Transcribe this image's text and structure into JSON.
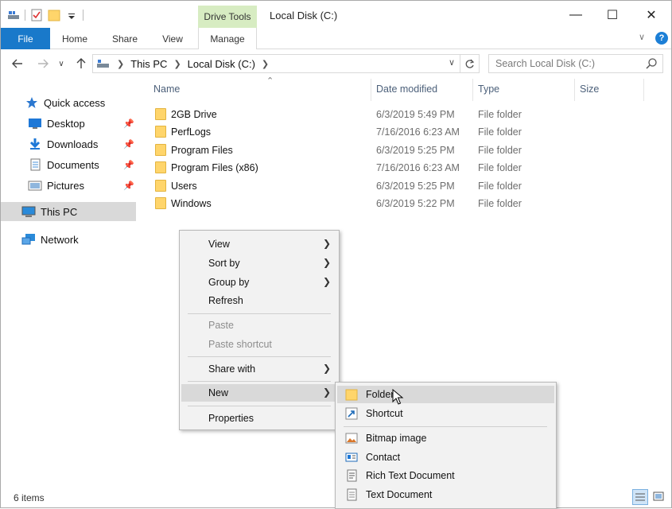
{
  "window": {
    "title": "Local Disk (C:)",
    "contextual_tab_group": "Drive Tools",
    "controls": {
      "minimize": "—",
      "maximize": "☐",
      "close": "✕"
    }
  },
  "ribbon": {
    "tabs": [
      {
        "label": "File"
      },
      {
        "label": "Home"
      },
      {
        "label": "Share"
      },
      {
        "label": "View"
      },
      {
        "label": "Manage"
      }
    ],
    "help": "?"
  },
  "address": {
    "crumbs": [
      "This PC",
      "Local Disk (C:)"
    ],
    "search_placeholder": "Search Local Disk (C:)"
  },
  "nav_pane": {
    "quick_access": "Quick access",
    "items": [
      {
        "label": "Desktop",
        "icon": "desktop-icon",
        "pinned": true
      },
      {
        "label": "Downloads",
        "icon": "downloads-icon",
        "pinned": true
      },
      {
        "label": "Documents",
        "icon": "documents-icon",
        "pinned": true
      },
      {
        "label": "Pictures",
        "icon": "pictures-icon",
        "pinned": true
      }
    ],
    "this_pc": "This PC",
    "network": "Network"
  },
  "columns": {
    "name": "Name",
    "date": "Date modified",
    "type": "Type",
    "size": "Size"
  },
  "files": [
    {
      "name": "2GB Drive",
      "date": "6/3/2019 5:49 PM",
      "type": "File folder"
    },
    {
      "name": "PerfLogs",
      "date": "7/16/2016 6:23 AM",
      "type": "File folder"
    },
    {
      "name": "Program Files",
      "date": "6/3/2019 5:25 PM",
      "type": "File folder"
    },
    {
      "name": "Program Files (x86)",
      "date": "7/16/2016 6:23 AM",
      "type": "File folder"
    },
    {
      "name": "Users",
      "date": "6/3/2019 5:25 PM",
      "type": "File folder"
    },
    {
      "name": "Windows",
      "date": "6/3/2019 5:22 PM",
      "type": "File folder"
    }
  ],
  "status": {
    "count": "6 items"
  },
  "context_menu": {
    "view": "View",
    "sort_by": "Sort by",
    "group_by": "Group by",
    "refresh": "Refresh",
    "paste": "Paste",
    "paste_shortcut": "Paste shortcut",
    "share_with": "Share with",
    "new": "New",
    "properties": "Properties"
  },
  "new_submenu": {
    "folder": "Folder",
    "shortcut": "Shortcut",
    "bitmap": "Bitmap image",
    "contact": "Contact",
    "rtf": "Rich Text Document",
    "text": "Text Document"
  },
  "colors": {
    "accent": "#1979ca",
    "drive_tools": "#d7ecc2",
    "folder": "#ffd56b",
    "selection": "#d9d9d9"
  }
}
